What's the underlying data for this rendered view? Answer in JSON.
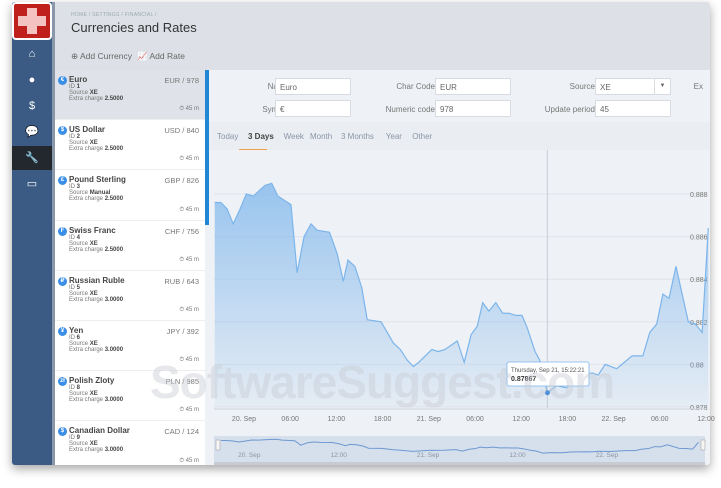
{
  "nav": {
    "items": [
      {
        "icon": "home-icon",
        "glyph": "⌂"
      },
      {
        "icon": "user-icon",
        "glyph": "●"
      },
      {
        "icon": "dollar-icon",
        "glyph": "$"
      },
      {
        "icon": "chat-icon",
        "glyph": "💬"
      },
      {
        "icon": "wrench-icon",
        "glyph": "🔧"
      },
      {
        "icon": "card-icon",
        "glyph": "▭"
      }
    ]
  },
  "header": {
    "breadcrumb": "HOME / SETTINGS / FINANCIAL /",
    "title": "Currencies and Rates"
  },
  "toolbar": {
    "add_currency": "⊕ Add Currency",
    "add_rate": "📈 Add Rate"
  },
  "currencies": [
    {
      "icon": "€",
      "name": "Euro",
      "code": "EUR / 978",
      "id_label": "ID",
      "id": "1",
      "source_label": "Source",
      "source": "XE",
      "charge_label": "Extra charge",
      "charge": "2.5000",
      "period": "⏱ 45 m"
    },
    {
      "icon": "$",
      "name": "US Dollar",
      "code": "USD / 840",
      "id_label": "ID",
      "id": "2",
      "source_label": "Source",
      "source": "XE",
      "charge_label": "Extra charge",
      "charge": "2.5000",
      "period": "⏱ 45 m"
    },
    {
      "icon": "£",
      "name": "Pound Sterling",
      "code": "GBP / 826",
      "id_label": "ID",
      "id": "3",
      "source_label": "Source",
      "source": "Manual",
      "charge_label": "Extra charge",
      "charge": "2.5000",
      "period": "⏱ 45 m"
    },
    {
      "icon": "F",
      "name": "Swiss Franc",
      "code": "CHF / 756",
      "id_label": "ID",
      "id": "4",
      "source_label": "Source",
      "source": "XE",
      "charge_label": "Extra charge",
      "charge": "2.5000",
      "period": "⏱ 45 m"
    },
    {
      "icon": "₽",
      "name": "Russian Ruble",
      "code": "RUB / 643",
      "id_label": "ID",
      "id": "5",
      "source_label": "Source",
      "source": "XE",
      "charge_label": "Extra charge",
      "charge": "3.0000",
      "period": "⏱ 45 m"
    },
    {
      "icon": "¥",
      "name": "Yen",
      "code": "JPY / 392",
      "id_label": "ID",
      "id": "6",
      "source_label": "Source",
      "source": "XE",
      "charge_label": "Extra charge",
      "charge": "3.0000",
      "period": "⏱ 45 m"
    },
    {
      "icon": "zł",
      "name": "Polish Zloty",
      "code": "PLN / 985",
      "id_label": "ID",
      "id": "8",
      "source_label": "Source",
      "source": "XE",
      "charge_label": "Extra charge",
      "charge": "3.0000",
      "period": "⏱ 45 m"
    },
    {
      "icon": "$",
      "name": "Canadian Dollar",
      "code": "CAD / 124",
      "id_label": "ID",
      "id": "9",
      "source_label": "Source",
      "source": "XE",
      "charge_label": "Extra charge",
      "charge": "3.0000",
      "period": "⏱ 45 m"
    }
  ],
  "form": {
    "name_label": "Name",
    "name": "Euro",
    "char_code_label": "Char Code",
    "char_code": "EUR",
    "source_label": "Source",
    "source": "XE",
    "extra_label": "Ex",
    "symbol_label": "Symbol",
    "symbol": "€",
    "numeric_label": "Numeric code",
    "numeric": "978",
    "period_label": "Update period",
    "period": "45"
  },
  "tabs": [
    "Today",
    "3 Days",
    "Week",
    "Month",
    "3 Months",
    "Year",
    "Other"
  ],
  "active_tab": "3 Days",
  "colors": {
    "line": "#7cb5ec",
    "accent": "#1f87d6",
    "tab_underline": "#f0a050"
  },
  "watermark": "SoftwareSuggest.com",
  "chart_data": {
    "type": "area",
    "x_unit": "hours since 20 Sep 00:00",
    "x": [
      -3.8,
      -3.0,
      -2.2,
      -1.4,
      -0.5,
      0.3,
      1.2,
      2.7,
      3.6,
      4.4,
      6.1,
      6.9,
      7.8,
      8.7,
      9.5,
      11.1,
      12.1,
      12.9,
      13.5,
      14.4,
      15.3,
      16.0,
      17.8,
      18.6,
      19.4,
      20.3,
      21.2,
      22.0,
      22.7,
      24.4,
      25.2,
      26.1,
      27.7,
      28.6,
      29.5,
      30.3,
      31.0,
      31.8,
      32.7,
      33.6,
      34.4,
      35.3,
      36.1,
      36.8,
      37.8,
      38.4,
      39.4,
      40.6,
      41.9,
      43.2,
      45.2,
      46.0,
      46.9,
      48.4,
      50.4,
      51.0,
      51.8,
      52.7,
      53.6,
      54.4,
      55.2,
      56.1,
      57.7,
      58.6,
      59.5,
      60.3
    ],
    "y": [
      0.8876,
      0.8876,
      0.8873,
      0.8866,
      0.8873,
      0.888,
      0.8879,
      0.8884,
      0.8885,
      0.8879,
      0.8875,
      0.8843,
      0.886,
      0.8866,
      0.8863,
      0.8862,
      0.8852,
      0.8839,
      0.8849,
      0.8846,
      0.8836,
      0.8821,
      0.882,
      0.8815,
      0.881,
      0.8807,
      0.8802,
      0.8799,
      0.8801,
      0.8807,
      0.8806,
      0.8807,
      0.8811,
      0.8801,
      0.8814,
      0.8818,
      0.8829,
      0.8825,
      0.8829,
      0.8824,
      0.8824,
      0.8823,
      0.8823,
      0.8817,
      0.8806,
      0.8802,
      0.87867,
      0.879,
      0.8789,
      0.8794,
      0.8796,
      0.8795,
      0.88,
      0.8798,
      0.8804,
      0.8804,
      0.8804,
      0.8815,
      0.8819,
      0.8833,
      0.8831,
      0.8846,
      0.882,
      0.8819,
      0.8815,
      0.8864
    ],
    "x_ticks": [
      {
        "h": 0,
        "label": "20. Sep"
      },
      {
        "h": 6,
        "label": "06:00"
      },
      {
        "h": 12,
        "label": "12:00"
      },
      {
        "h": 18,
        "label": "18:00"
      },
      {
        "h": 24,
        "label": "21. Sep"
      },
      {
        "h": 30,
        "label": "06:00"
      },
      {
        "h": 36,
        "label": "12:00"
      },
      {
        "h": 42,
        "label": "18:00"
      },
      {
        "h": 48,
        "label": "22. Sep"
      },
      {
        "h": 54,
        "label": "06:00"
      },
      {
        "h": 60,
        "label": "12:00"
      }
    ],
    "y_ticks": [
      0.888,
      0.886,
      0.884,
      0.882,
      0.88,
      0.878
    ],
    "y_tick_labels": [
      "0.888",
      "0.886",
      "0.884",
      "0.882",
      "0.88",
      "0.878"
    ],
    "ylim": [
      0.878,
      0.888
    ],
    "navigator_labels": [
      {
        "h": 0,
        "label": "20. Sep"
      },
      {
        "h": 12,
        "label": "12:00"
      },
      {
        "h": 24,
        "label": "21. Sep"
      },
      {
        "h": 36,
        "label": "12:00"
      },
      {
        "h": 48,
        "label": "22. Sep"
      }
    ],
    "tooltip": {
      "h": 39.4,
      "date": "Thursday, Sep 21, 15:22:21",
      "value": "0.87867"
    }
  }
}
